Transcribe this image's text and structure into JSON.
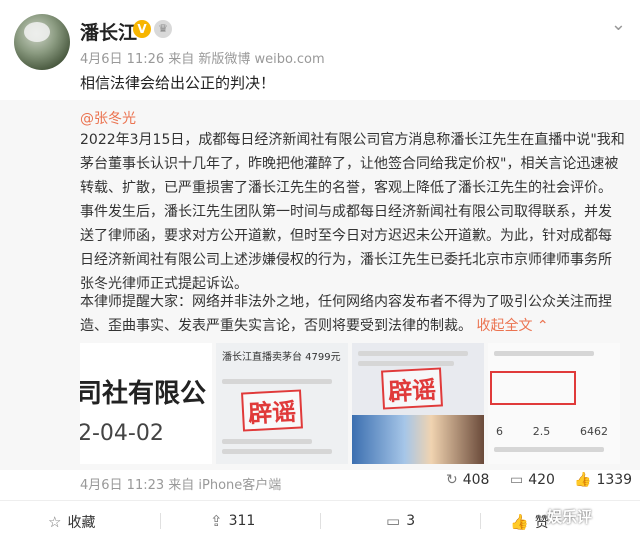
{
  "author": {
    "name": "潘长江",
    "verified_badge": "V",
    "meta": "4月6日 11:26 来自 新版微博 weibo.com"
  },
  "post": {
    "text": "相信法律会给出公正的判决！"
  },
  "repost": {
    "mention": "@张冬光",
    "paragraph1": "2022年3月15日，成都每日经济新闻社有限公司官方消息称潘长江先生在直播中说\"我和茅台董事长认识十几年了，昨晚把他灌醉了，让他签合同给我定价权\"，相关言论迅速被转载、扩散，已严重损害了潘长江先生的名誉，客观上降低了潘长江先生的社会评价。事件发生后，潘长江先生团队第一时间与成都每日经济新闻社有限公司取得联系，并发送了律师函，要求对方公开道歉，但时至今日对方迟迟未公开道歉。为此，针对成都每日经济新闻社有限公司上述涉嫌侵权的行为，潘长江先生已委托北京市京师律师事务所张冬光律师正式提起诉讼。",
    "paragraph2": "本律师提醒大家：网络并非法外之地，任何网络内容发布者不得为了吸引公众关注而捏造、歪曲事实、发表严重失实言论，否则将要受到法律的制裁。",
    "expand_label": "收起全文",
    "expand_arrow": "⌃",
    "images": [
      {
        "big": "司社有限公",
        "date": "2-04-02"
      },
      {
        "header": "潘长江直播卖茅台 4799元",
        "stamp": "辟谣"
      },
      {
        "stamp": "辟谣"
      },
      {
        "nums": [
          "6",
          "2.5",
          "6462"
        ]
      }
    ],
    "meta": "4月6日 11:23 来自 iPhone客户端",
    "stats": {
      "reposts": "408",
      "comments": "420",
      "likes": "1339"
    }
  },
  "actions": {
    "favorite": "收藏",
    "repost": "311",
    "comment": "3",
    "like": "赞"
  },
  "watermark": "娱乐评"
}
